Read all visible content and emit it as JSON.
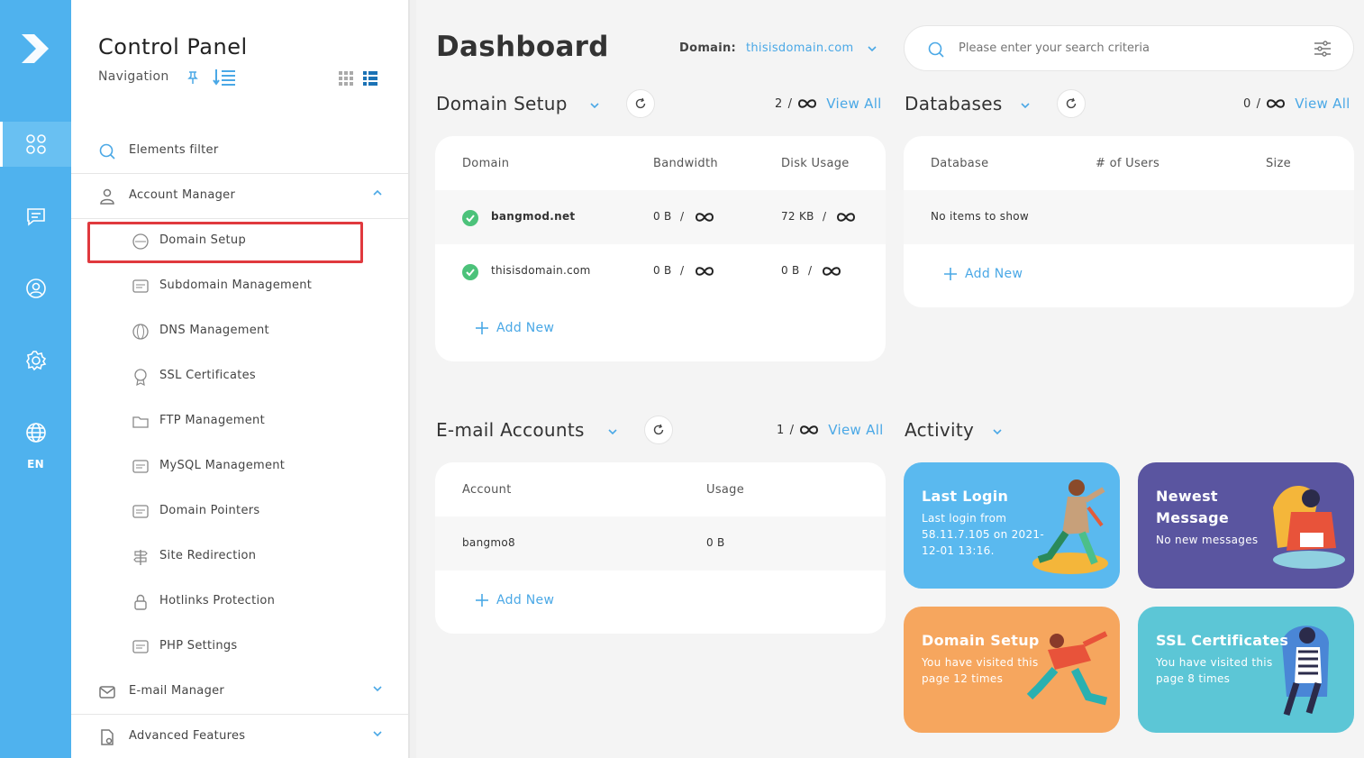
{
  "rail": {
    "lang": "EN"
  },
  "sidebar": {
    "title": "Control Panel",
    "nav_label": "Navigation",
    "filter_label": "Elements filter",
    "account_manager": "Account Manager",
    "sub_items": [
      {
        "label": "Domain Setup",
        "icon": "www-icon"
      },
      {
        "label": "Subdomain Management",
        "icon": "subdomain-icon"
      },
      {
        "label": "DNS Management",
        "icon": "dns-icon"
      },
      {
        "label": "SSL Certificates",
        "icon": "ssl-icon"
      },
      {
        "label": "FTP Management",
        "icon": "ftp-icon"
      },
      {
        "label": "MySQL Management",
        "icon": "sql-icon"
      },
      {
        "label": "Domain Pointers",
        "icon": "pointer-icon"
      },
      {
        "label": "Site Redirection",
        "icon": "signpost-icon"
      },
      {
        "label": "Hotlinks Protection",
        "icon": "lock-icon"
      },
      {
        "label": "PHP Settings",
        "icon": "php-icon"
      }
    ],
    "email_manager": "E-mail Manager",
    "advanced_features": "Advanced Features"
  },
  "header": {
    "title": "Dashboard",
    "domain_label": "Domain:",
    "domain_value": "thisisdomain.com",
    "search_placeholder": "Please enter your search criteria"
  },
  "domain_setup": {
    "title": "Domain Setup",
    "count": "2",
    "slash": "/",
    "view_all": "View All",
    "columns": [
      "Domain",
      "Bandwidth",
      "Disk Usage"
    ],
    "rows": [
      {
        "domain": "bangmod.net",
        "bandwidth": "0 B",
        "disk": "72 KB"
      },
      {
        "domain": "thisisdomain.com",
        "bandwidth": "0 B",
        "disk": "0 B"
      }
    ],
    "add_new": "Add New"
  },
  "databases": {
    "title": "Databases",
    "count": "0",
    "slash": "/",
    "view_all": "View All",
    "columns": [
      "Database",
      "# of Users",
      "Size"
    ],
    "empty": "No items to show",
    "add_new": "Add New"
  },
  "email_accounts": {
    "title": "E-mail Accounts",
    "count": "1",
    "slash": "/",
    "view_all": "View All",
    "columns": [
      "Account",
      "Usage"
    ],
    "rows": [
      {
        "account": "bangmo8",
        "usage": "0 B"
      }
    ],
    "add_new": "Add New"
  },
  "activity": {
    "title": "Activity",
    "tiles": [
      {
        "title": "Last Login",
        "desc_lines": [
          "Last login from",
          "58.11.7.105 on 2021-",
          "12-01 13:16."
        ],
        "color": "#5ab9ef"
      },
      {
        "title_lines": [
          "Newest",
          "Message"
        ],
        "desc": "No new messages",
        "color": "#5a55a0"
      },
      {
        "title": "Domain Setup",
        "desc_lines": [
          "You have visited this",
          "page 12 times"
        ],
        "color": "#f6a65e"
      },
      {
        "title": "SSL Certificates",
        "desc_lines": [
          "You have visited this",
          "page 8 times"
        ],
        "color": "#5cc6d6"
      }
    ]
  },
  "colors": {
    "accent": "#4aa8e6",
    "rail": "#4fb2ee",
    "highlight": "#e0393e",
    "ok": "#4cc27a"
  }
}
